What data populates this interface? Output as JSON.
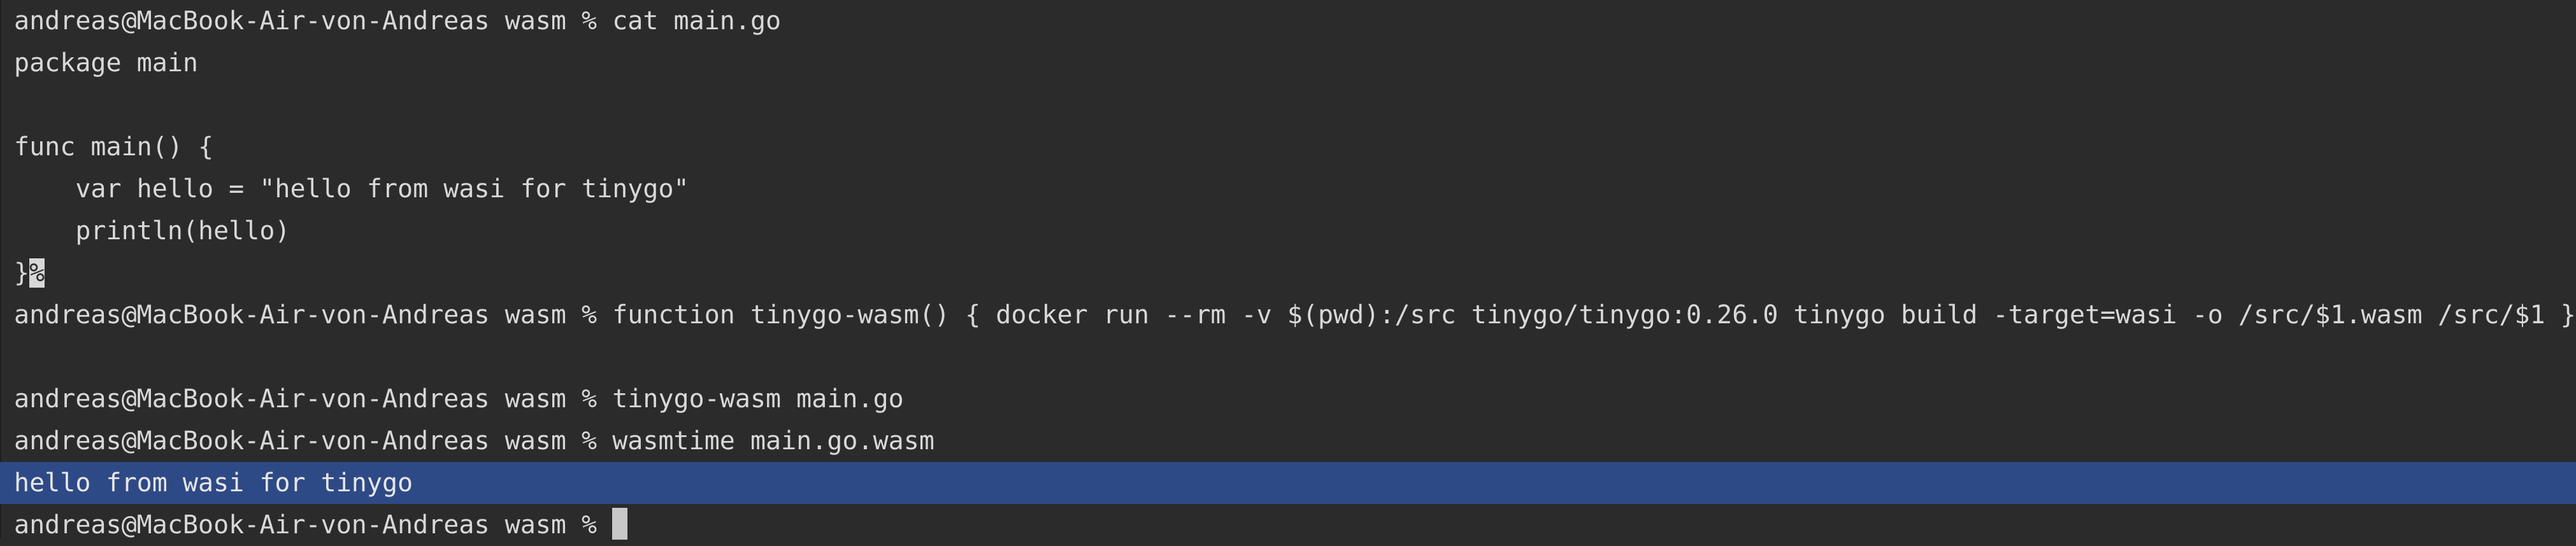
{
  "terminal": {
    "lines": [
      "andreas@MacBook-Air-von-Andreas wasm % cat main.go",
      "package main",
      "",
      "func main() {",
      "    var hello = \"hello from wasi for tinygo\"",
      "    println(hello)",
      "}",
      "andreas@MacBook-Air-von-Andreas wasm % function tinygo-wasm() { docker run --rm -v $(pwd):/src tinygo/tinygo:0.26.0 tinygo build -target=wasi -o /src/$1.wasm /src/$1 }",
      "",
      "andreas@MacBook-Air-von-Andreas wasm % tinygo-wasm main.go",
      "andreas@MacBook-Air-von-Andreas wasm % wasmtime main.go.wasm",
      "hello from wasi for tinygo",
      "andreas@MacBook-Air-von-Andreas wasm % "
    ],
    "eof_mark": "%",
    "colors": {
      "background": "#2b2b2b",
      "text": "#d8d8d8",
      "selection": "#2e4a86",
      "cursor": "#c8c8c8"
    }
  }
}
